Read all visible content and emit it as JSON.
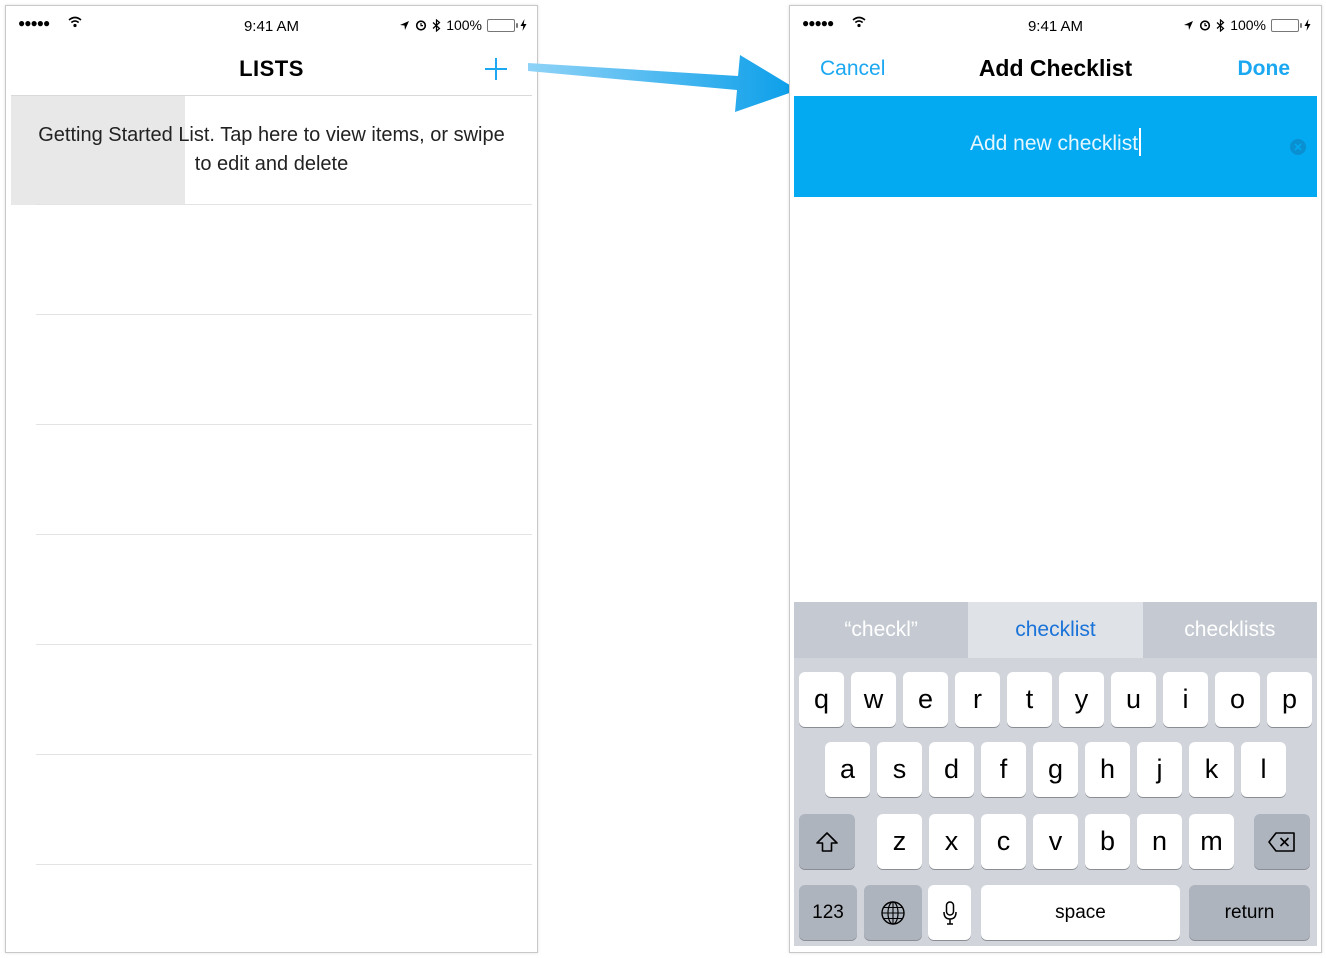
{
  "status_bar": {
    "signal": "●●●●●",
    "time": "9:41 AM",
    "battery": "100%",
    "battery_level": 1.0
  },
  "left_screen": {
    "title": "LISTS",
    "add_icon": "plus-icon",
    "list_items": [
      {
        "text": "Getting Started List. Tap here to view items, or swipe to edit and delete"
      }
    ]
  },
  "right_screen": {
    "cancel_label": "Cancel",
    "title": "Add Checklist",
    "done_label": "Done",
    "input": {
      "value": "Add new checklist"
    },
    "suggestions": [
      "“checkl”",
      "checklist",
      "checklists"
    ],
    "keyboard": {
      "row1": [
        "q",
        "w",
        "e",
        "r",
        "t",
        "y",
        "u",
        "i",
        "o",
        "p"
      ],
      "row2": [
        "a",
        "s",
        "d",
        "f",
        "g",
        "h",
        "j",
        "k",
        "l"
      ],
      "row3": [
        "z",
        "x",
        "c",
        "v",
        "b",
        "n",
        "m"
      ],
      "numbers_label": "123",
      "space_label": "space",
      "return_label": "return"
    }
  },
  "colors": {
    "accent": "#1ba8f0",
    "input_band": "#04aaf1",
    "battery": "#4cd964"
  }
}
